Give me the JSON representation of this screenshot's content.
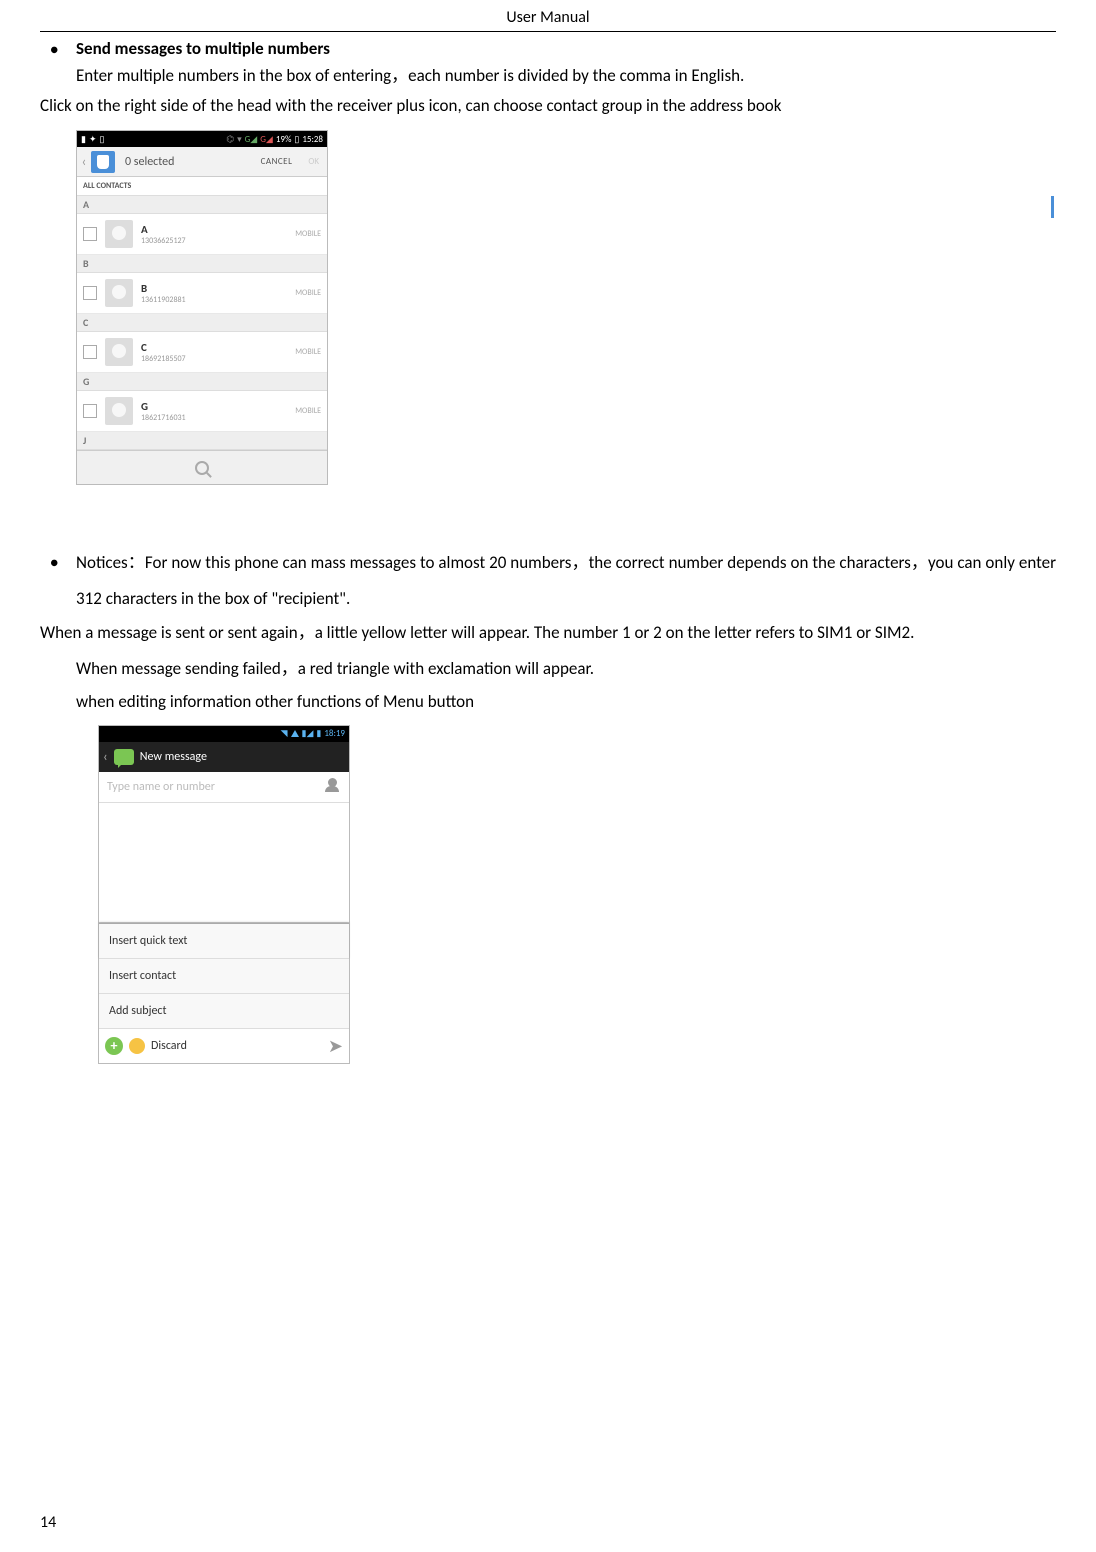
{
  "header": {
    "title": "User    Manual"
  },
  "bullet1": {
    "heading": "Send messages to multiple numbers"
  },
  "para1": "Enter multiple numbers in the box of entering，each number is divided by the comma in English.",
  "para2": "Click on the right side of the head with the receiver plus icon, can choose contact group in the address book",
  "phone1": {
    "status": {
      "battery": "19%",
      "time": "15:28"
    },
    "selected": "0 selected",
    "cancel": "CANCEL",
    "ok": "OK",
    "tab": "ALL CONTACTS",
    "sections": [
      {
        "letter": "A",
        "contacts": [
          {
            "name": "A",
            "number": "13036625127",
            "type": "MOBILE"
          }
        ]
      },
      {
        "letter": "B",
        "contacts": [
          {
            "name": "B",
            "number": "13611902881",
            "type": "MOBILE"
          }
        ]
      },
      {
        "letter": "C",
        "contacts": [
          {
            "name": "C",
            "number": "18692185507",
            "type": "MOBILE"
          }
        ]
      },
      {
        "letter": "G",
        "contacts": [
          {
            "name": "G",
            "number": "18621716031",
            "type": "MOBILE"
          }
        ]
      },
      {
        "letter": "J",
        "contacts": []
      }
    ]
  },
  "bullet2": "Notices：For now this phone can mass messages to almost 20 numbers，the correct number depends on the characters，you can only enter 312 characters in the box of \"recipient\".",
  "para3": "When a message is sent or sent again，a little yellow letter will appear. The number 1 or 2 on the letter refers to SIM1 or SIM2.",
  "para4": "When message sending failed，a red triangle with exclamation will appear.",
  "para5": "when editing information other functions of Menu button",
  "phone2": {
    "status": {
      "time": "18:19"
    },
    "title": "New message",
    "placeholder": "Type name or number",
    "menu": [
      "Insert quick text",
      "Insert contact",
      "Add subject",
      "Discard"
    ]
  },
  "page_number": "14"
}
